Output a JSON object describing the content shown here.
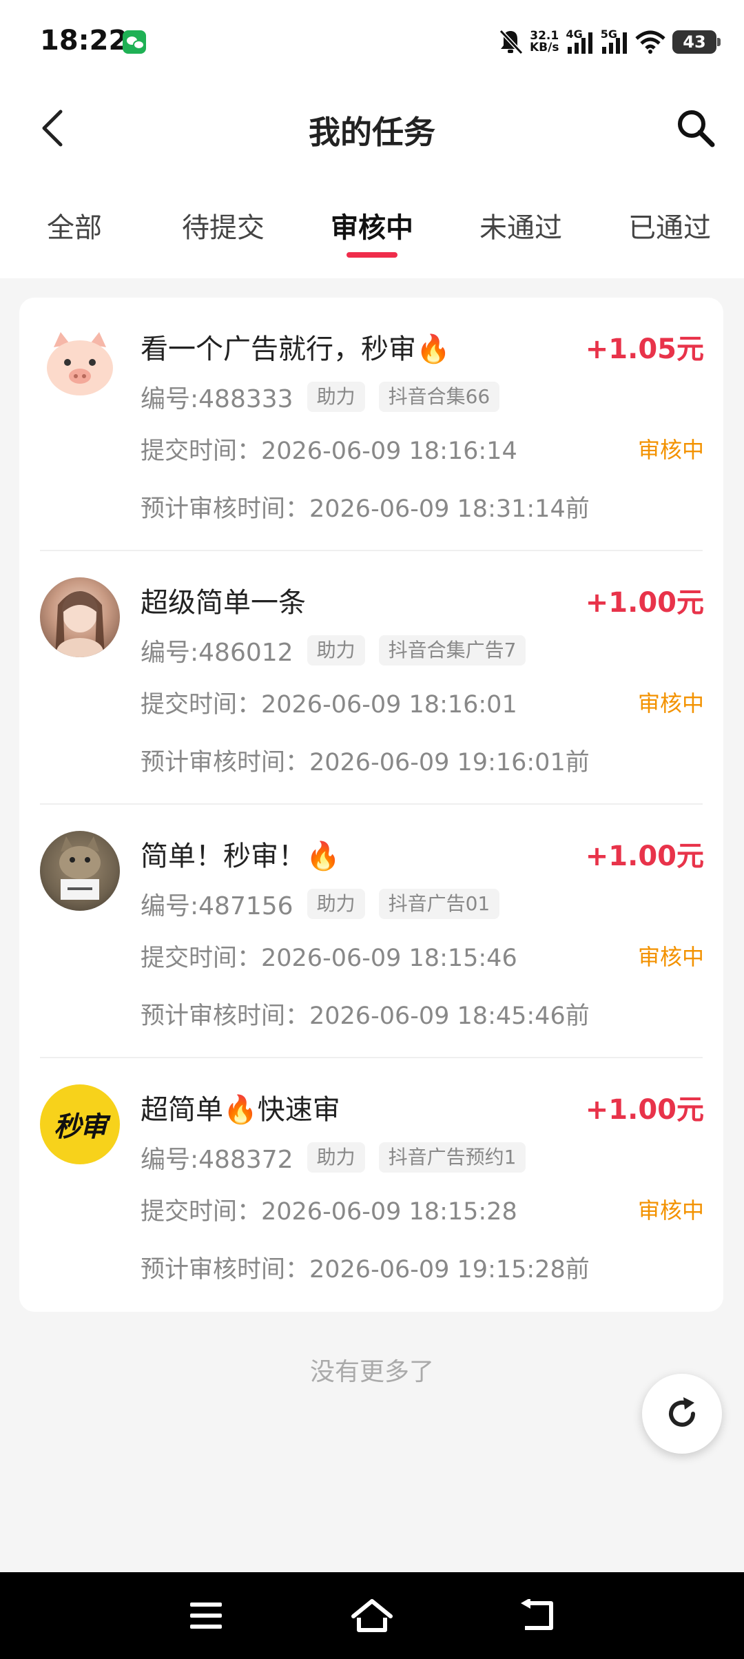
{
  "status_bar": {
    "time": "18:22",
    "net_speed_value": "32.1",
    "net_speed_unit": "KB/s",
    "signal1_label": "4G",
    "signal2_label": "5G",
    "battery": "43"
  },
  "header": {
    "title": "我的任务"
  },
  "tabs": [
    {
      "label": "全部"
    },
    {
      "label": "待提交"
    },
    {
      "label": "审核中"
    },
    {
      "label": "未通过"
    },
    {
      "label": "已通过"
    }
  ],
  "active_tab": "审核中",
  "tasks": [
    {
      "title": "看一个广告就行，秒审🔥",
      "reward": "+1.05元",
      "id": "编号:488333",
      "tag1": "助力",
      "tag2": "抖音合集66",
      "submit_time": "提交时间：2026-06-09 18:16:14",
      "status": "审核中",
      "review_time": "预计审核时间：2026-06-09 18:31:14前",
      "avatar": "pig-avatar"
    },
    {
      "title": "超级简单一条",
      "reward": "+1.00元",
      "id": "编号:486012",
      "tag1": "助力",
      "tag2": "抖音合集广告7",
      "submit_time": "提交时间：2026-06-09 18:16:01",
      "status": "审核中",
      "review_time": "预计审核时间：2026-06-09 19:16:01前",
      "avatar": "girl-photo-avatar"
    },
    {
      "title": "简单！秒审！🔥",
      "reward": "+1.00元",
      "id": "编号:487156",
      "tag1": "助力",
      "tag2": "抖音广告01",
      "submit_time": "提交时间：2026-06-09 18:15:46",
      "status": "审核中",
      "review_time": "预计审核时间：2026-06-09 18:45:46前",
      "avatar": "cat-photo-avatar"
    },
    {
      "title": "超简单🔥快速审",
      "reward": "+1.00元",
      "id": "编号:488372",
      "tag1": "助力",
      "tag2": "抖音广告预约1",
      "submit_time": "提交时间：2026-06-09 18:15:28",
      "status": "审核中",
      "review_time": "预计审核时间：2026-06-09 19:15:28前",
      "avatar": "miaoshen-logo-avatar",
      "avatar_text": "秒审"
    }
  ],
  "footer_text": "没有更多了",
  "icons": {
    "back": "back-arrow-icon",
    "search": "search-icon",
    "refresh": "refresh-icon",
    "nav_menu": "menu-icon",
    "nav_home": "home-icon",
    "nav_back": "return-icon"
  },
  "colors": {
    "accent_red": "#e8334a",
    "tab_underline": "#ef2d4b",
    "status_orange": "#f39200",
    "background": "#f5f5f5"
  }
}
